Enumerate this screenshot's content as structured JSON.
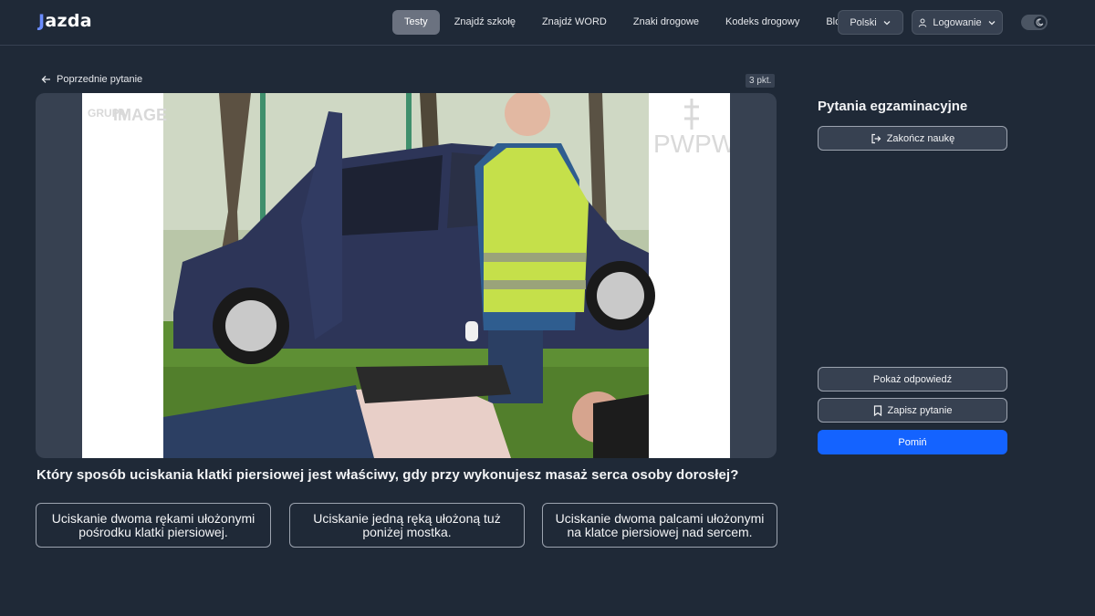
{
  "header": {
    "logo": {
      "mark": "J",
      "rest": "azda"
    },
    "nav": [
      "Testy",
      "Znajdź szkołę",
      "Znajdź WORD",
      "Znaki drogowe",
      "Kodeks drogowy",
      "Blog"
    ],
    "active_nav": "Testy",
    "language": "Polski",
    "login": "Logowanie",
    "theme_toggle_icon": "moon-icon"
  },
  "main": {
    "back_label": "Poprzednie pytanie",
    "points": "3 pkt.",
    "image": {
      "watermark_left": [
        "GRUPA",
        "IMAGE"
      ],
      "watermark_right": "PWPW"
    },
    "question": "Który sposób uciskania klatki piersiowej jest właściwy, gdy przy wykonujesz masaż serca osoby dorosłej?",
    "answers": [
      "Uciskanie dwoma rękami ułożonymi pośrodku klatki piersiowej.",
      "Uciskanie jedną ręką ułożoną tuż poniżej mostka.",
      "Uciskanie dwoma palcami ułożonymi na klatce piersiowej nad sercem."
    ]
  },
  "sidebar": {
    "title": "Pytania egzaminacyjne",
    "finish_label": "Zakończ naukę",
    "show_answer_label": "Pokaż odpowiedź",
    "save_label": "Zapisz pytanie",
    "skip_label": "Pomiń"
  },
  "colors": {
    "background": "#1f2937",
    "panel": "#374151",
    "accent": "#1463ff",
    "logo_accent": "#6b8cff"
  }
}
